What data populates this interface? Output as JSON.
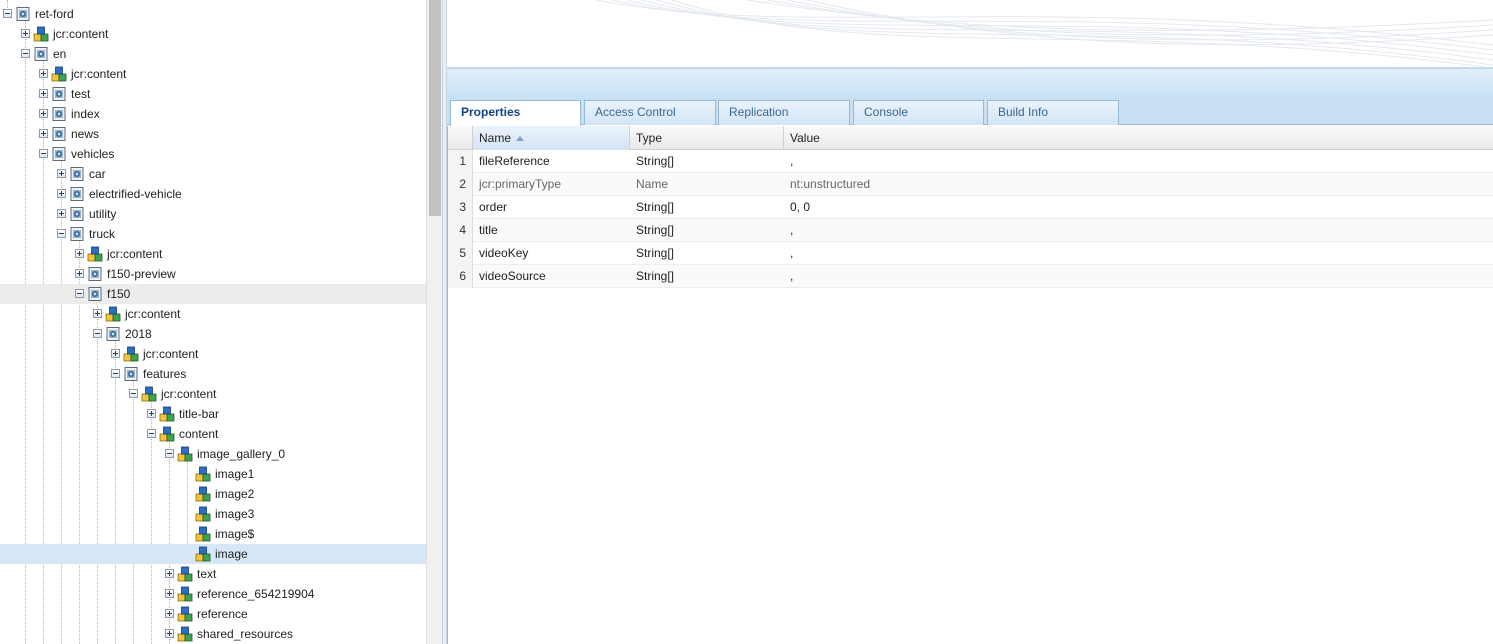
{
  "tree": {
    "nodes": [
      {
        "label": "ret-ford",
        "depth": 0,
        "toggle": "minus",
        "icon": "page-icon"
      },
      {
        "label": "jcr:content",
        "depth": 1,
        "toggle": "plus",
        "icon": "content-node-icon"
      },
      {
        "label": "en",
        "depth": 1,
        "toggle": "minus",
        "icon": "page-icon"
      },
      {
        "label": "jcr:content",
        "depth": 2,
        "toggle": "plus",
        "icon": "content-node-icon"
      },
      {
        "label": "test",
        "depth": 2,
        "toggle": "plus",
        "icon": "page-icon"
      },
      {
        "label": "index",
        "depth": 2,
        "toggle": "plus",
        "icon": "page-icon"
      },
      {
        "label": "news",
        "depth": 2,
        "toggle": "plus",
        "icon": "page-icon"
      },
      {
        "label": "vehicles",
        "depth": 2,
        "toggle": "minus",
        "icon": "page-icon"
      },
      {
        "label": "car",
        "depth": 3,
        "toggle": "plus",
        "icon": "page-icon"
      },
      {
        "label": "electrified-vehicle",
        "depth": 3,
        "toggle": "plus",
        "icon": "page-icon"
      },
      {
        "label": "utility",
        "depth": 3,
        "toggle": "plus",
        "icon": "page-icon"
      },
      {
        "label": "truck",
        "depth": 3,
        "toggle": "minus",
        "icon": "page-icon"
      },
      {
        "label": "jcr:content",
        "depth": 4,
        "toggle": "plus",
        "icon": "content-node-icon"
      },
      {
        "label": "f150-preview",
        "depth": 4,
        "toggle": "plus",
        "icon": "page-icon"
      },
      {
        "label": "f150",
        "depth": 4,
        "toggle": "minus",
        "icon": "page-icon",
        "highlighted": true
      },
      {
        "label": "jcr:content",
        "depth": 5,
        "toggle": "plus",
        "icon": "content-node-icon"
      },
      {
        "label": "2018",
        "depth": 5,
        "toggle": "minus",
        "icon": "page-icon"
      },
      {
        "label": "jcr:content",
        "depth": 6,
        "toggle": "plus",
        "icon": "content-node-icon"
      },
      {
        "label": "features",
        "depth": 6,
        "toggle": "minus",
        "icon": "page-icon"
      },
      {
        "label": "jcr:content",
        "depth": 7,
        "toggle": "minus",
        "icon": "content-node-icon"
      },
      {
        "label": "title-bar",
        "depth": 8,
        "toggle": "plus",
        "icon": "content-node-icon"
      },
      {
        "label": "content",
        "depth": 8,
        "toggle": "minus",
        "icon": "content-node-icon"
      },
      {
        "label": "image_gallery_0",
        "depth": 9,
        "toggle": "minus",
        "icon": "content-node-icon"
      },
      {
        "label": "image1",
        "depth": 10,
        "toggle": "none",
        "icon": "content-node-icon"
      },
      {
        "label": "image2",
        "depth": 10,
        "toggle": "none",
        "icon": "content-node-icon"
      },
      {
        "label": "image3",
        "depth": 10,
        "toggle": "none",
        "icon": "content-node-icon"
      },
      {
        "label": "image$",
        "depth": 10,
        "toggle": "none",
        "icon": "content-node-icon"
      },
      {
        "label": "image",
        "depth": 10,
        "toggle": "none",
        "icon": "content-node-icon",
        "selected": true
      },
      {
        "label": "text",
        "depth": 9,
        "toggle": "plus",
        "icon": "content-node-icon"
      },
      {
        "label": "reference_654219904",
        "depth": 9,
        "toggle": "plus",
        "icon": "content-node-icon"
      },
      {
        "label": "reference",
        "depth": 9,
        "toggle": "plus",
        "icon": "content-node-icon"
      },
      {
        "label": "shared_resources",
        "depth": 9,
        "toggle": "plus",
        "icon": "content-node-icon"
      }
    ]
  },
  "tabs": [
    {
      "label": "Properties",
      "active": true
    },
    {
      "label": "Access Control",
      "active": false
    },
    {
      "label": "Replication",
      "active": false
    },
    {
      "label": "Console",
      "active": false
    },
    {
      "label": "Build Info",
      "active": false
    }
  ],
  "grid": {
    "columns": {
      "name": "Name",
      "type": "Type",
      "value": "Value"
    },
    "sort_column": "Name",
    "sort_direction": "ascending",
    "rows": [
      {
        "num": "1",
        "name": "fileReference",
        "type": "String[]",
        "value": ","
      },
      {
        "num": "2",
        "name": "jcr:primaryType",
        "type": "Name",
        "value": "nt:unstructured",
        "protected": true
      },
      {
        "num": "3",
        "name": "order",
        "type": "String[]",
        "value": "0, 0"
      },
      {
        "num": "4",
        "name": "title",
        "type": "String[]",
        "value": ","
      },
      {
        "num": "5",
        "name": "videoKey",
        "type": "String[]",
        "value": ","
      },
      {
        "num": "6",
        "name": "videoSource",
        "type": "String[]",
        "value": ","
      }
    ]
  },
  "colors": {
    "accent": "#15428b",
    "tab_text": "#39688f",
    "selection": "#d6e8f8",
    "tree_guides": "#e3a1a1"
  }
}
